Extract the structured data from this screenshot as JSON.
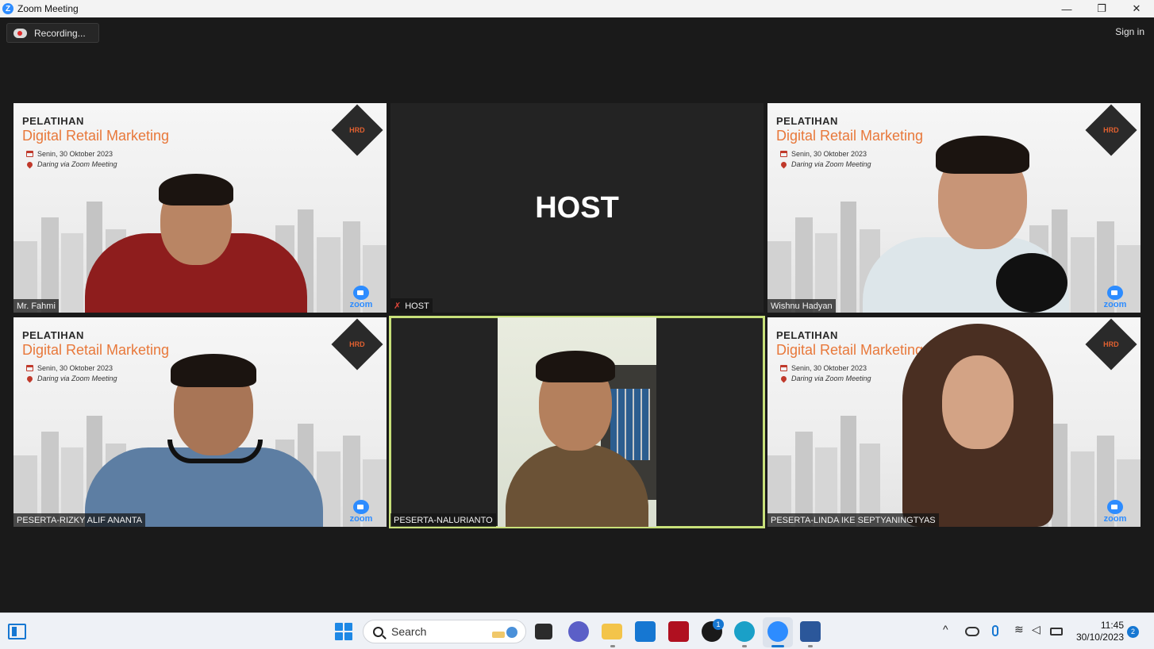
{
  "window": {
    "app_icon": "Z",
    "title": "Zoom Meeting",
    "controls": {
      "minimize": "—",
      "restore": "❐",
      "close": "✕"
    }
  },
  "meeting": {
    "recording_label": "Recording...",
    "sign_in": "Sign in"
  },
  "slide": {
    "kicker": "PELATIHAN",
    "title": "Digital Retail Marketing",
    "date": "Senin, 30 Oktober 2023",
    "place": "Daring via Zoom Meeting",
    "logo_text": "HRD",
    "zoom_word": "zoom"
  },
  "tiles": [
    {
      "name": "Mr. Fahmi",
      "type": "slide"
    },
    {
      "name": "HOST",
      "type": "host",
      "center_text": "HOST",
      "muted": true
    },
    {
      "name": "Wishnu Hadyan",
      "type": "slide"
    },
    {
      "name": "PESERTA-RIZKY ALIF ANANTA",
      "type": "slide"
    },
    {
      "name": "PESERTA-NALURIANTO",
      "type": "camera",
      "speaking": true
    },
    {
      "name": "PESERTA-LINDA IKE SEPTYANINGTYAS",
      "type": "slide"
    }
  ],
  "taskbar": {
    "search_label": "Search",
    "xbox_badge": "1",
    "clock_time": "11:45",
    "clock_date": "30/10/2023",
    "notification_count": "2",
    "colors": {
      "accent": "#1677d2",
      "zoom_blue": "#2d8cff",
      "speaking_outline": "#c8e07a"
    }
  }
}
